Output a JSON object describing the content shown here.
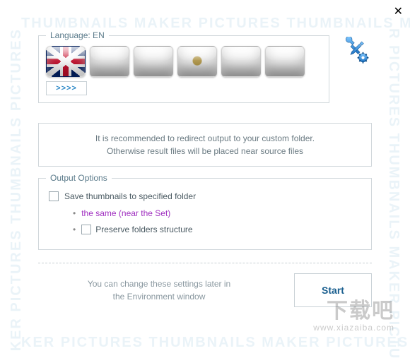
{
  "watermark": {
    "text": "THUMBNAILS MAKER PICTURES THUMBNAILS MAKE",
    "side_left": "KER PICTURES THUMBNAILS   PICTURES",
    "side_right": "R PICTURES THUMBNAILS MAKER PICTU",
    "bottom": "KER PICTURES THUMBNAILS MAKER PICTURES THUMBNAILS MA"
  },
  "site_watermark": {
    "big": "下载吧",
    "small": "www.xiazaiba.com"
  },
  "language": {
    "legend": "Language: EN",
    "more_label": ">>>>",
    "flags": [
      "uk",
      "blank",
      "blank",
      "es",
      "blank",
      "blank"
    ]
  },
  "info": {
    "line1": "It is recommended to redirect output to your custom folder.",
    "line2": "Otherwise result files will be placed near source files"
  },
  "output": {
    "legend": "Output Options",
    "save_label": "Save thumbnails to specified folder",
    "same_label": "the same (near the Set)",
    "preserve_label": "Preserve folders structure"
  },
  "footer": {
    "note_line1": "You can change these settings later in",
    "note_line2": "the Environment  window",
    "start_label": "Start"
  }
}
